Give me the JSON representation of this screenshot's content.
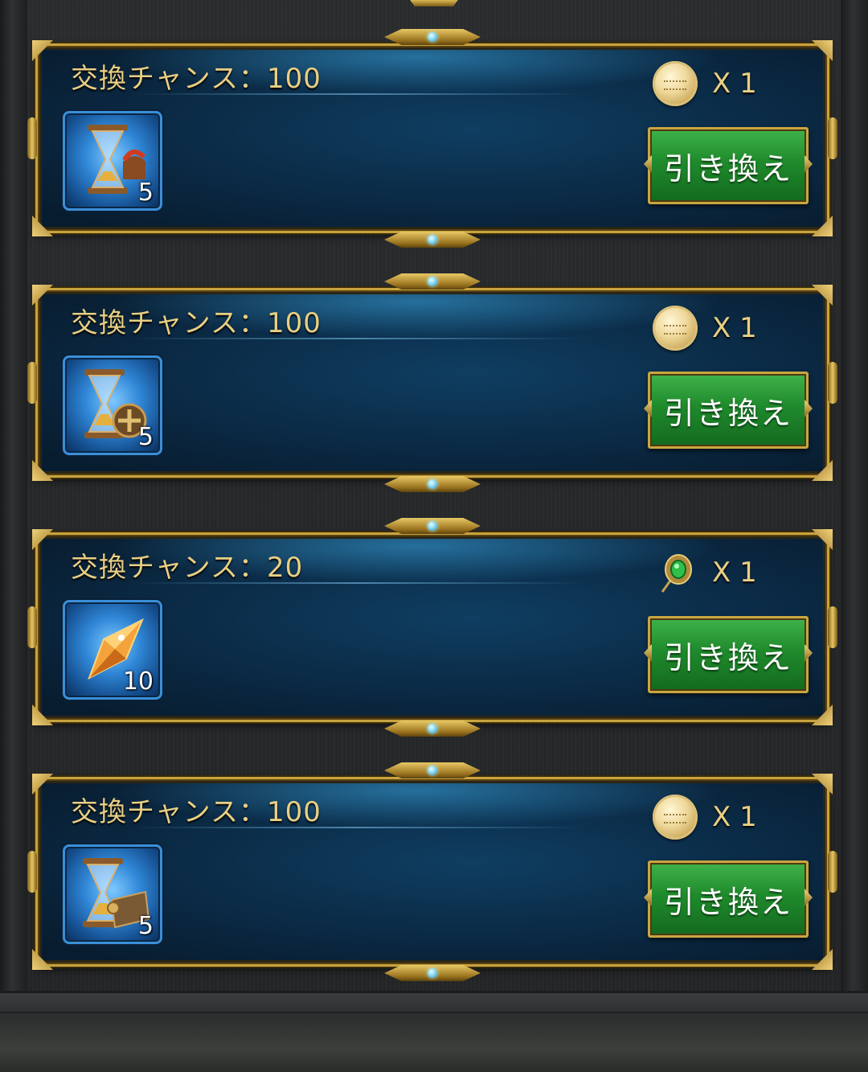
{
  "cards": [
    {
      "title": "交換チャンス：100",
      "item_icon": "hourglass-helmet-icon",
      "item_quantity": "5",
      "cost_icon": "gold-coin-icon",
      "cost_text": "X 1",
      "button_label": "引き換え"
    },
    {
      "title": "交換チャンス：100",
      "item_icon": "hourglass-medal-icon",
      "item_quantity": "5",
      "cost_icon": "gold-coin-icon",
      "cost_text": "X 1",
      "button_label": "引き換え"
    },
    {
      "title": "交換チャンス：20",
      "item_icon": "orange-crystal-icon",
      "item_quantity": "10",
      "cost_icon": "emerald-amulet-icon",
      "cost_text": "X 1",
      "button_label": "引き換え"
    },
    {
      "title": "交換チャンス：100",
      "item_icon": "hourglass-book-icon",
      "item_quantity": "5",
      "cost_icon": "gold-coin-icon",
      "cost_text": "X 1",
      "button_label": "引き換え"
    }
  ],
  "colors": {
    "title_gold": "#e9cf83",
    "frame_gold": "#c8a43e",
    "panel_blue": "#0b2c48",
    "button_green": "#1f8a2c"
  }
}
